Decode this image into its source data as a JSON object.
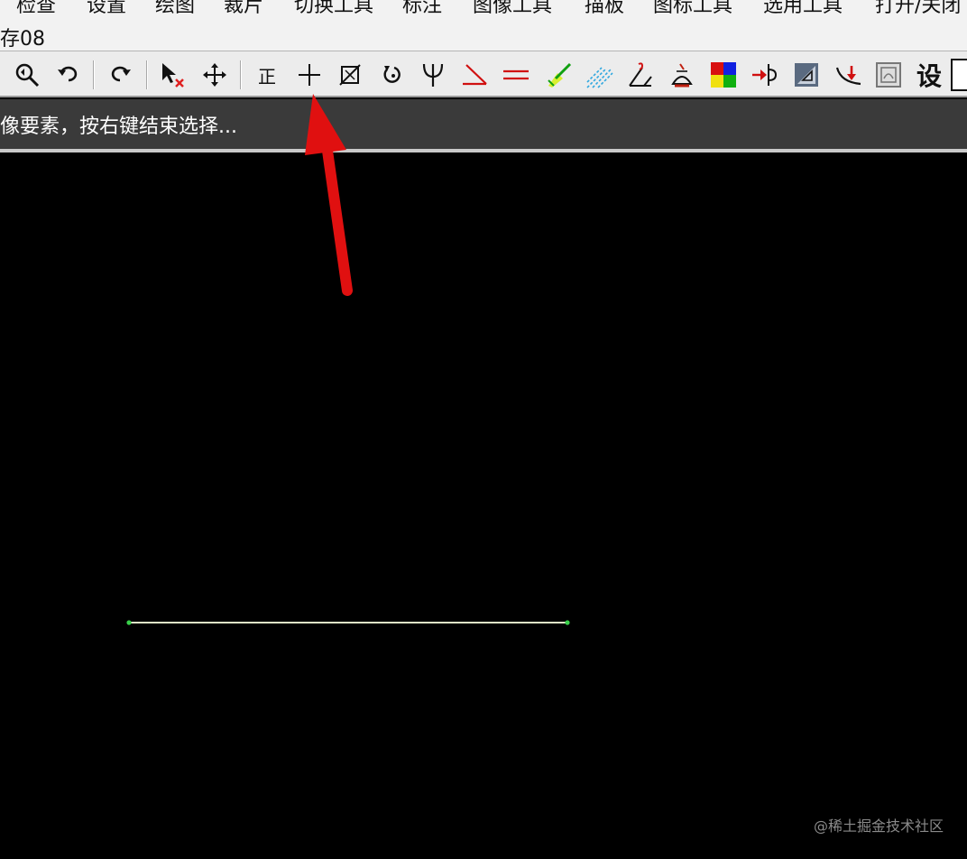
{
  "menu": {
    "items": [
      "检查",
      "设置",
      "绘图",
      "裁片",
      "切换工具",
      "标注",
      "图像工具",
      "描板",
      "图标工具",
      "选用工具",
      "打开/关闭"
    ]
  },
  "window": {
    "title_fragment": "存08"
  },
  "toolbar": {
    "tools": [
      {
        "icon": "zoom-icon"
      },
      {
        "icon": "undo-icon"
      },
      {
        "icon": "redo-icon"
      },
      {
        "icon": "select-delete-icon"
      },
      {
        "icon": "move-icon"
      },
      {
        "icon": "correct-icon",
        "glyph": "正"
      },
      {
        "icon": "crosshair-icon"
      },
      {
        "icon": "rectangle-cut-icon"
      },
      {
        "icon": "rotate-icon"
      },
      {
        "icon": "trident-icon"
      },
      {
        "icon": "angle-icon"
      },
      {
        "icon": "parallel-lines-icon"
      },
      {
        "icon": "highlighter-icon"
      },
      {
        "icon": "hatch-icon"
      },
      {
        "icon": "measure-angle-icon"
      },
      {
        "icon": "stamp-icon"
      },
      {
        "icon": "color-palette-icon"
      },
      {
        "icon": "arrow-join-icon"
      },
      {
        "icon": "triangle-frame-icon"
      },
      {
        "icon": "curve-down-icon"
      },
      {
        "icon": "image-frame-icon"
      },
      {
        "icon": "settings-text-icon",
        "glyph": "设"
      }
    ]
  },
  "status": {
    "prompt": "像要素，按右键结束选择..."
  },
  "colors": {
    "line": "#dfe9c8",
    "endpoint": "#39d04a",
    "arrow": "#e01010"
  },
  "watermark": "@稀土掘金技术社区"
}
